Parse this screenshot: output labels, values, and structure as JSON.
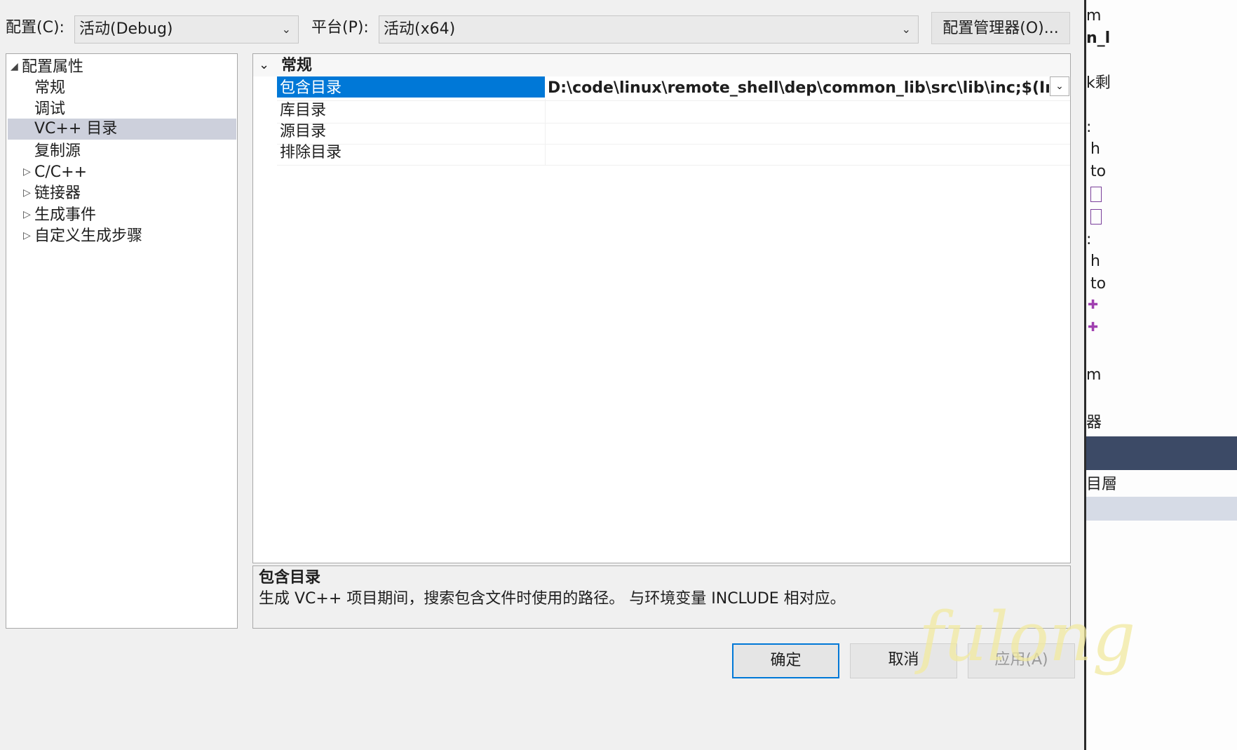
{
  "config": {
    "config_label": "配置(C):",
    "config_value": "活动(Debug)",
    "platform_label": "平台(P):",
    "platform_value": "活动(x64)",
    "config_manager_button": "配置管理器(O)..."
  },
  "tree": {
    "root": "配置属性",
    "items": [
      "常规",
      "调试",
      "VC++ 目录",
      "复制源"
    ],
    "expandable": [
      "C/C++",
      "链接器",
      "生成事件",
      "自定义生成步骤"
    ],
    "selected": "VC++ 目录"
  },
  "grid": {
    "category": "常规",
    "rows": [
      {
        "name": "包含目录",
        "value": "D:\\code\\linux\\remote_shell\\dep\\common_lib\\src\\lib\\inc;$(IncludePath)"
      },
      {
        "name": "库目录",
        "value": ""
      },
      {
        "name": "源目录",
        "value": ""
      },
      {
        "name": "排除目录",
        "value": ""
      }
    ]
  },
  "description": {
    "title": "包含目录",
    "text": "生成 VC++ 项目期间，搜索包含文件时使用的路径。 与环境变量 INCLUDE 相对应。"
  },
  "buttons": {
    "ok": "确定",
    "cancel": "取消",
    "apply": "应用(A)"
  },
  "background_fragments": [
    "m",
    "n_l",
    "k剩",
    ":",
    "h",
    "to",
    ":",
    "h",
    "to",
    "m",
    "器",
    "目層"
  ],
  "watermark": "fulong",
  "colors": {
    "selection": "#0078d7",
    "tree_selection": "#cdd0dc",
    "window_bg": "#f0f0f0"
  }
}
